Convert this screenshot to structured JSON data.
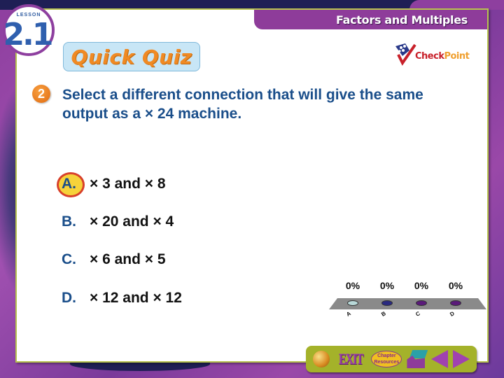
{
  "header": {
    "lesson_label": "LESSON",
    "lesson_number": "2.1",
    "title": "Factors and Multiples",
    "quiz_title": "Quick Quiz",
    "checkpoint": {
      "check": "Check",
      "point": "Point"
    }
  },
  "question": {
    "number": "2",
    "text": "Select a different connection that will give the same output as a × 24 machine."
  },
  "options": [
    {
      "letter": "A.",
      "text": "× 3 and × 8",
      "correct": true
    },
    {
      "letter": "B.",
      "text": "× 20 and × 4",
      "correct": false
    },
    {
      "letter": "C.",
      "text": "× 6 and × 5",
      "correct": false
    },
    {
      "letter": "D.",
      "text": "× 12 and × 12",
      "correct": false
    }
  ],
  "poll": {
    "results": [
      {
        "label": "A",
        "percent": "0%",
        "color": "#b8d8d8"
      },
      {
        "label": "B",
        "percent": "0%",
        "color": "#2a2a80"
      },
      {
        "label": "C",
        "percent": "0%",
        "color": "#5a1a7a"
      },
      {
        "label": "D",
        "percent": "0%",
        "color": "#5a1a7a"
      }
    ]
  },
  "nav": {
    "exit_label": "EXIT",
    "chapter_resources_line1": "Chapter",
    "chapter_resources_line2": "Resources"
  },
  "colors": {
    "brand_purple": "#8e3c9a",
    "accent_green": "#a4b22a",
    "question_blue": "#1a4e8a",
    "quiz_orange": "#f08a24"
  }
}
